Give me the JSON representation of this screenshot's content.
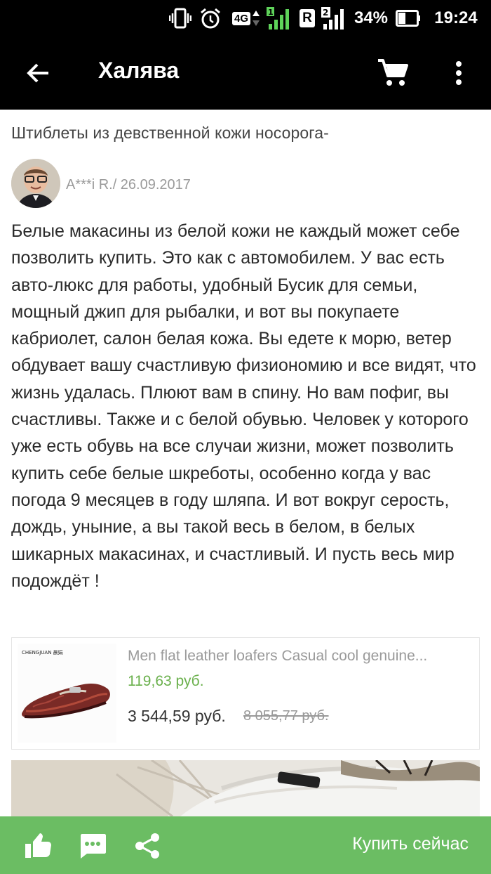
{
  "status_bar": {
    "network": "4G",
    "sim2": "R",
    "battery": "34%",
    "time": "19:24"
  },
  "app_bar": {
    "title": "Халява",
    "icons": [
      "arrow-left-icon",
      "shopping-cart-icon",
      "more-vert-icon"
    ]
  },
  "review": {
    "title": "Штиблеты из девственной кожи носорога-",
    "author": "A***i R./ 26.09.2017",
    "body": "Белые макасины из белой кожи не каждый может себе позволить купить. Это как с автомобилем. У вас есть авто-люкс для работы, удобный Бусик для семьи, мощный джип для рыбалки, и вот вы покупаете кабриолет, салон белая кожа. Вы едете к морю, ветер обдувает вашу счастливую физиономию и все видят, что жизнь удалась. Плюют вам в спину. Но вам пофиг, вы счастливы. Также и с белой обувью. Человек у которого уже есть обувь на все случаи жизни, может позволить купить себе белые шкреботы, особенно когда у вас погода 9 месяцев в году шляпа. И вот вокруг серость, дождь, уныние, а вы такой весь в белом, в белых шикарных макасинах, и счастливый. И пусть весь мир подождёт !"
  },
  "product": {
    "name": "Men flat leather loafers Casual cool genuine...",
    "shipping": "119,63 руб.",
    "price": "3 544,59 руб.",
    "old_price": "8 055,77 руб.",
    "brand_mark": "CHENGJUAN 晨娟"
  },
  "bottom_bar": {
    "buy_label": "Купить сейчас",
    "icons": [
      "thumbs-up-icon",
      "comment-icon",
      "share-icon"
    ]
  },
  "colors": {
    "accent_green": "#6bbd63",
    "price_green": "#6ab04c",
    "bar_black": "#000000"
  }
}
